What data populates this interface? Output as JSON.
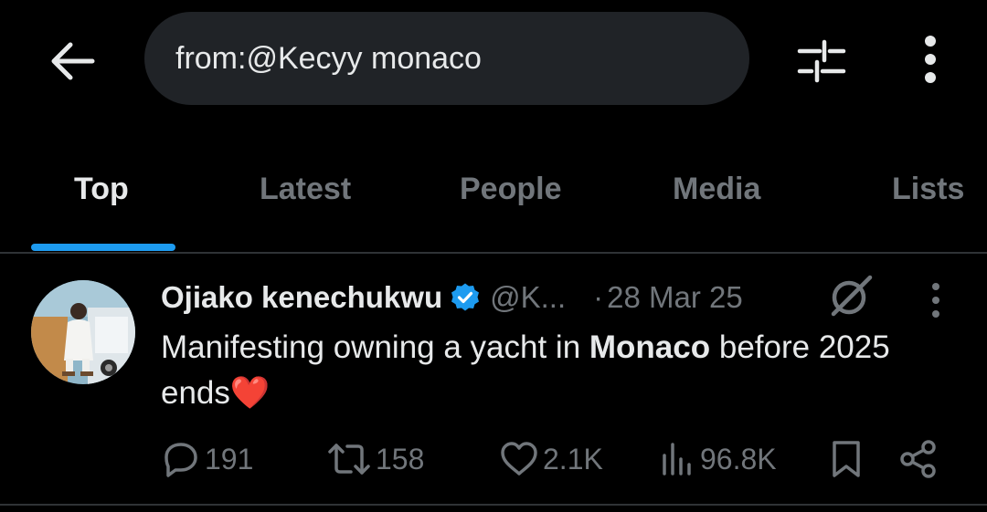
{
  "header": {
    "search_value": "from:@Kecyy monaco",
    "back_icon": "arrow-left-icon",
    "filter_icon": "sliders-icon",
    "more_icon": "vertical-ellipsis-icon"
  },
  "tabs": [
    {
      "label": "Top",
      "active": true
    },
    {
      "label": "Latest",
      "active": false
    },
    {
      "label": "People",
      "active": false
    },
    {
      "label": "Media",
      "active": false
    },
    {
      "label": "Lists",
      "active": false
    }
  ],
  "tweet": {
    "author_name": "Ojiako kenechukwu",
    "verified": true,
    "handle": "@K...",
    "separator": "·",
    "date": "28 Mar 25",
    "text_before": "Manifesting owning a yacht in ",
    "text_bold": "Monaco",
    "text_after": " before 2025 ends",
    "emoji": "❤️",
    "stats": {
      "replies": "191",
      "reposts": "158",
      "likes": "2.1K",
      "views": "96.8K"
    }
  },
  "colors": {
    "background": "#000000",
    "text_primary": "#e7e9ea",
    "text_secondary": "#71767b",
    "accent": "#1d9bf0",
    "search_bg": "#202327",
    "divider": "#2f3336"
  }
}
